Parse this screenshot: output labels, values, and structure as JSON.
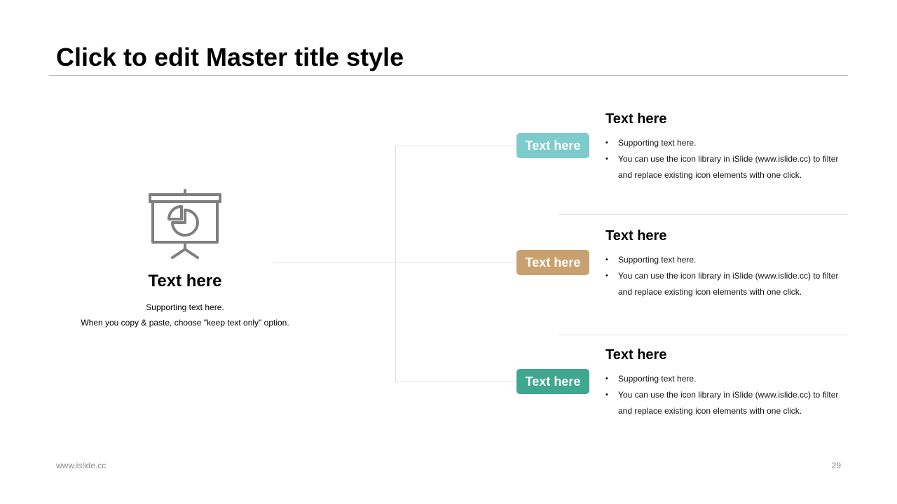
{
  "slide": {
    "title": "Click to edit Master title style",
    "page_number": "29"
  },
  "footer": {
    "website": "www.islide.cc"
  },
  "left_block": {
    "icon": "presentation-board-pie-chart-icon",
    "heading": "Text here",
    "line1": "Supporting text here.",
    "line2": "When you copy & paste, choose \"keep text only\" option."
  },
  "items": [
    {
      "tag": "Text here",
      "tag_color": "#7ecbcb",
      "heading": "Text here",
      "bullets": [
        "Supporting text here.",
        "You can use the icon library in iSlide  (www.islide.cc) to filter and replace existing icon elements with one click."
      ]
    },
    {
      "tag": "Text here",
      "tag_color": "#c9a170",
      "heading": "Text here",
      "bullets": [
        "Supporting text here.",
        "You can use the icon library in iSlide  (www.islide.cc) to filter and replace existing icon elements with one click."
      ]
    },
    {
      "tag": "Text here",
      "tag_color": "#3fa68f",
      "heading": "Text here",
      "bullets": [
        "Supporting text here.",
        "You can use the icon library in iSlide  (www.islide.cc) to filter and replace existing icon elements with one click."
      ]
    }
  ],
  "colors": {
    "icon": "#7f7f7f",
    "connector": "#e0e0e0"
  }
}
